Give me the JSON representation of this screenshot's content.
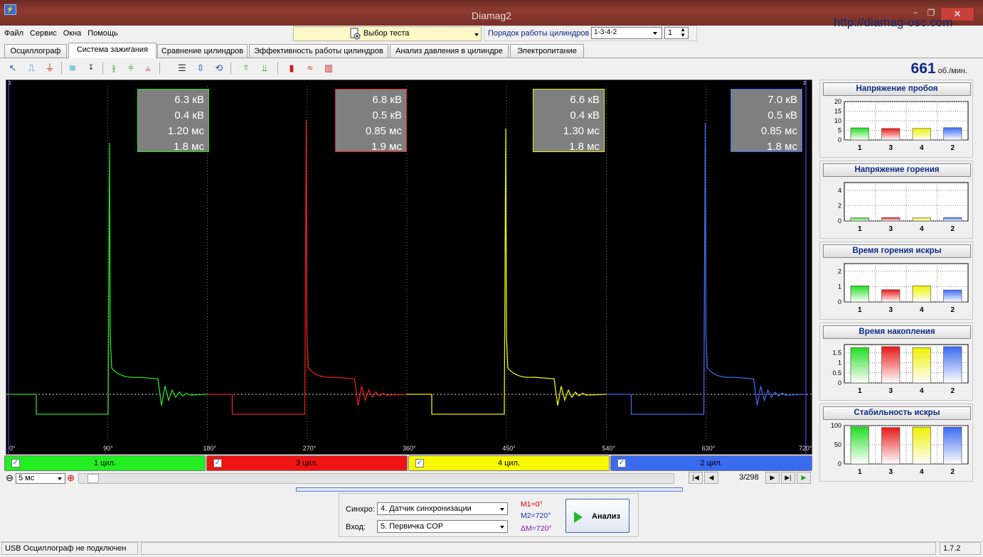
{
  "window": {
    "title": "Diamag2",
    "url": "http://diamag-osc.com",
    "minimize": "−",
    "restore": "❐",
    "close": "✕"
  },
  "menu": [
    "Файл",
    "Сервис",
    "Окна",
    "Помощь"
  ],
  "test_select": {
    "label": "Выбор теста"
  },
  "cylinder_order": {
    "label": "Порядок работы цилиндров",
    "value": "1-3-4-2",
    "spin_value": "1"
  },
  "tabs": [
    "Осциллограф",
    "Система зажигания",
    "Сравнение цилиндров",
    "Эффективность работы цилиндров",
    "Анализ давления в цилиндре",
    "Электропитание"
  ],
  "active_tab": "Система зажигания",
  "rpm": {
    "value": "661",
    "unit": "об./мин."
  },
  "oscillogram": {
    "axis_ticks": [
      "0°",
      "90°",
      "180°",
      "270°",
      "360°",
      "450°",
      "540°",
      "630°",
      "720°"
    ],
    "markers": {
      "left": "1",
      "right": "2"
    },
    "measurements": [
      {
        "cyl": "1",
        "color": "#22e022",
        "lines": [
          "6.3 кВ",
          "0.4 кВ",
          "1.20 мс",
          "1.8 мс"
        ]
      },
      {
        "cyl": "3",
        "color": "#e82020",
        "lines": [
          "6.8 кВ",
          "0.5 кВ",
          "0.85 мс",
          "1.9 мс"
        ]
      },
      {
        "cyl": "4",
        "color": "#f0f000",
        "lines": [
          "6.6 кВ",
          "0.4 кВ",
          "1.30 мс",
          "1.8 мс"
        ]
      },
      {
        "cyl": "2",
        "color": "#3a6af0",
        "lines": [
          "7.0 кВ",
          "0.5 кВ",
          "0.85 мс",
          "1.8 мс"
        ]
      }
    ]
  },
  "cylinder_bar": [
    {
      "label": "1 цил.",
      "color": "#22ee22"
    },
    {
      "label": "3 цил.",
      "color": "#ee1414"
    },
    {
      "label": "4 цил.",
      "color": "#f8f800"
    },
    {
      "label": "2 цил.",
      "color": "#3a6af0"
    }
  ],
  "nav": {
    "zoom": "5 мс",
    "page": "3/298",
    "zoom_out": "⊖",
    "zoom_in": "⊕",
    "first": "|◀",
    "prev": "◀",
    "next": "▶",
    "last": "▶|",
    "play": "▶"
  },
  "panels": [
    {
      "title": "Напряжение пробоя",
      "yticks": [
        "20",
        "15",
        "10",
        "5",
        "0"
      ],
      "ymax": 20,
      "cyls": [
        "1",
        "3",
        "4",
        "2"
      ],
      "values": [
        6.3,
        6.0,
        6.0,
        6.4
      ]
    },
    {
      "title": "Напряжение горения",
      "yticks": [
        "4",
        "2",
        "0"
      ],
      "ymax": 5,
      "cyls": [
        "1",
        "3",
        "4",
        "2"
      ],
      "values": [
        0.4,
        0.45,
        0.4,
        0.45
      ]
    },
    {
      "title": "Время горения искры",
      "yticks": [
        "2",
        "1",
        "0"
      ],
      "ymax": 2.5,
      "cyls": [
        "1",
        "3",
        "4",
        "2"
      ],
      "values": [
        1.05,
        0.8,
        1.05,
        0.78
      ]
    },
    {
      "title": "Время накопления",
      "yticks": [
        "1.5",
        "1",
        "0.5",
        "0"
      ],
      "ymax": 1.9,
      "cyls": [
        "1",
        "3",
        "4",
        "2"
      ],
      "values": [
        1.75,
        1.8,
        1.75,
        1.8
      ]
    },
    {
      "title": "Стабильность искры",
      "yticks": [
        "100",
        "50",
        "0"
      ],
      "ymax": 100,
      "cyls": [
        "1",
        "3",
        "4",
        "2"
      ],
      "values": [
        97,
        95,
        96,
        96
      ]
    }
  ],
  "bar_colors": [
    "#22dd22",
    "#e81818",
    "#f0f000",
    "#3a6af0"
  ],
  "sync": {
    "sync_label": "Синхро:",
    "sync_value": "4.  Датчик синхронизации",
    "input_label": "Вход:",
    "input_value": "5.  Первичка COP"
  },
  "markers_info": {
    "m1": "M1=0°",
    "m2": "M2=720°",
    "dm": "ΔM=720°"
  },
  "analyze_button": "Анализ",
  "status": {
    "left": "USB Осциллограф не подключен",
    "version": "1.7.2"
  }
}
